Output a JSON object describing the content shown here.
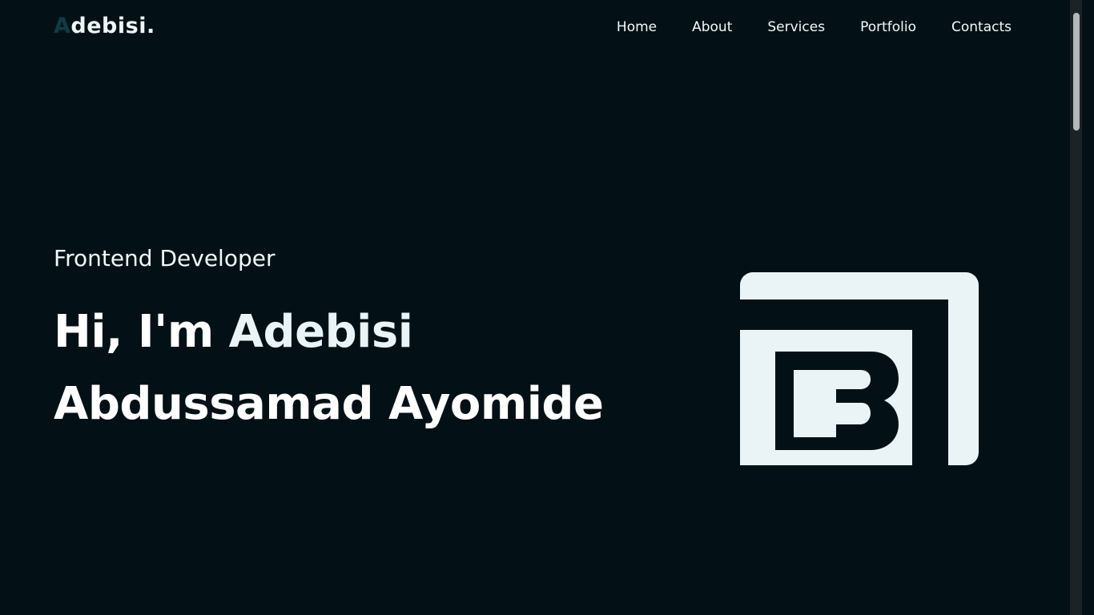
{
  "header": {
    "logo_first": "A",
    "logo_rest": "debisi."
  },
  "nav": {
    "home": "Home",
    "about": "About",
    "services": "Services",
    "portfolio": "Portfolio",
    "contacts": "Contacts"
  },
  "hero": {
    "subtitle": "Frontend Developer",
    "greeting": "Hi, I'm ",
    "name_line1": "Adebisi",
    "name_line2": "Abdussamad Ayomide"
  },
  "colors": {
    "background": "#031116",
    "text": "#f4f8f9",
    "logo_accent": "#0d3c43",
    "mark": "#eaf4f7"
  }
}
